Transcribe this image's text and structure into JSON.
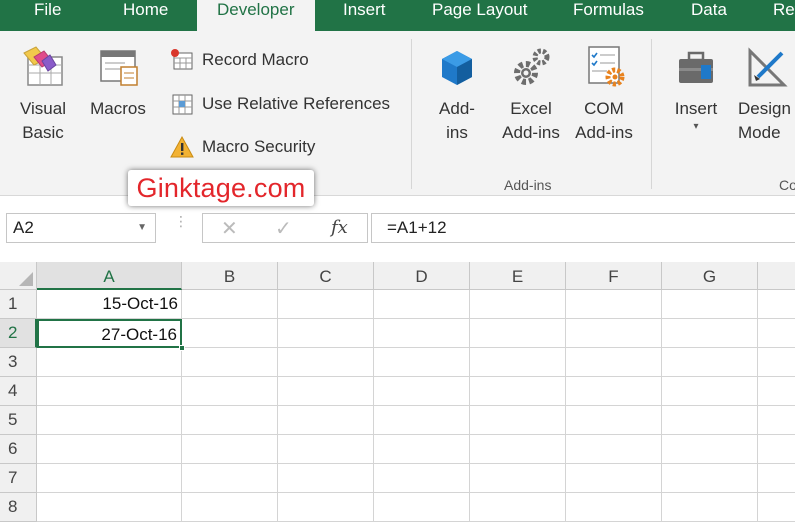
{
  "tabs": [
    "File",
    "Home",
    "Developer",
    "Insert",
    "Page Layout",
    "Formulas",
    "Data",
    "Rev"
  ],
  "active_tab": "Developer",
  "ribbon": {
    "visual_basic": "Visual\nBasic",
    "macros": "Macros",
    "record_macro": "Record Macro",
    "use_relative": "Use Relative References",
    "macro_security": "Macro Security",
    "addins": "Add-\nins",
    "excel_addins": "Excel\nAdd-ins",
    "com_addins": "COM\nAdd-ins",
    "addins_group": "Add-ins",
    "insert": "Insert",
    "design_mode": "Design\nMode",
    "controls_group_partial": "Co"
  },
  "watermark": "Ginktage.com",
  "formula_bar": {
    "name_box": "A2",
    "formula": "=A1+12"
  },
  "columns": [
    "A",
    "B",
    "C",
    "D",
    "E",
    "F",
    "G"
  ],
  "rows": [
    "1",
    "2",
    "3",
    "4",
    "5",
    "6",
    "7",
    "8"
  ],
  "cells": {
    "A1": "15-Oct-16",
    "A2": "27-Oct-16"
  },
  "colors": {
    "accent": "#217346",
    "watermark": "#e3262b"
  }
}
